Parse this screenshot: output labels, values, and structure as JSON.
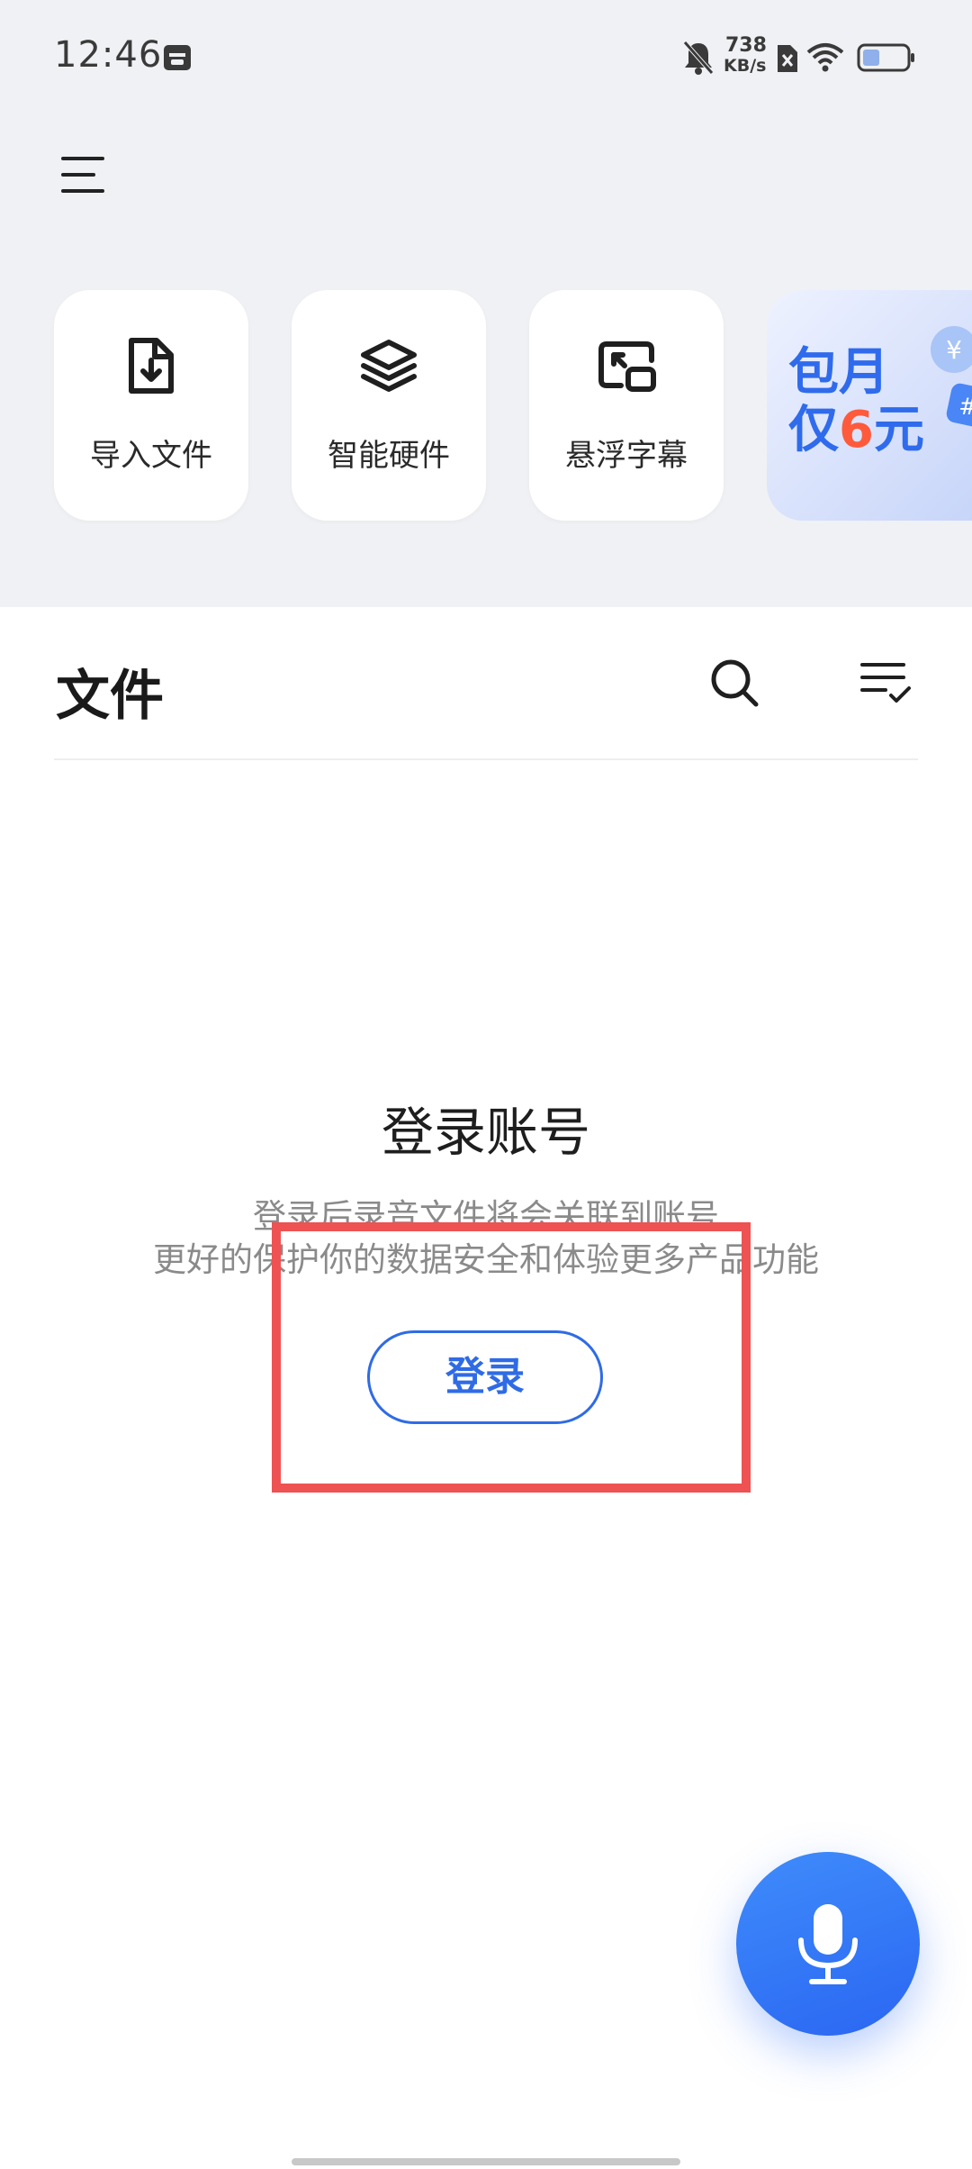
{
  "status_bar": {
    "time": "12:46",
    "net_speed_value": "738",
    "net_speed_unit": "KB/s"
  },
  "quick_actions": [
    {
      "label": "导入文件",
      "icon": "file-import-icon"
    },
    {
      "label": "智能硬件",
      "icon": "layers-icon"
    },
    {
      "label": "悬浮字幕",
      "icon": "floating-window-icon"
    }
  ],
  "promo": {
    "line1": "包月",
    "line2_prefix": "仅",
    "line2_number": "6",
    "line2_suffix": "元"
  },
  "files": {
    "title": "文件"
  },
  "login": {
    "title": "登录账号",
    "description_line1": "登录后录音文件将会关联到账号",
    "description_line2": "更好的保护你的数据安全和体验更多产品功能",
    "button_label": "登录"
  },
  "colors": {
    "accent": "#2f6be5",
    "highlight": "#ee5252",
    "top_background": "#f0f1f4"
  }
}
